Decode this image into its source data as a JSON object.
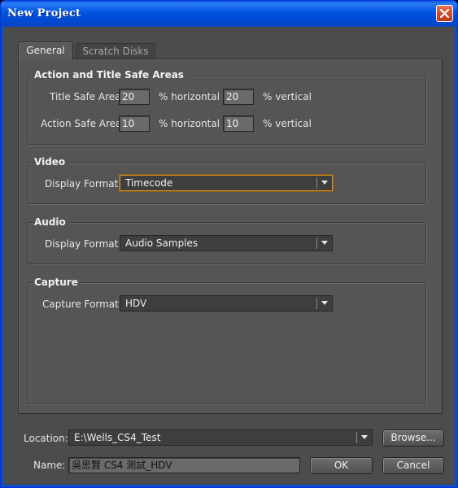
{
  "window": {
    "title": "New Project"
  },
  "tabs": [
    {
      "label": "General",
      "active": true
    },
    {
      "label": "Scratch Disks",
      "active": false
    }
  ],
  "safe_areas": {
    "title": "Action and Title Safe Areas",
    "title_safe_label": "Title Safe Area",
    "title_safe_h": "20",
    "title_safe_v": "20",
    "action_safe_label": "Action Safe Area",
    "action_safe_h": "10",
    "action_safe_v": "10",
    "unit_h": "% horizontal",
    "unit_v": "% vertical"
  },
  "video": {
    "title": "Video",
    "display_format_label": "Display Format:",
    "display_format": "Timecode"
  },
  "audio": {
    "title": "Audio",
    "display_format_label": "Display Format:",
    "display_format": "Audio Samples"
  },
  "capture": {
    "title": "Capture",
    "capture_format_label": "Capture Format:",
    "capture_format": "HDV"
  },
  "location": {
    "label": "Location:",
    "value": "E:\\Wells_CS4_Test",
    "browse_label": "Browse..."
  },
  "name": {
    "label": "Name:",
    "value": "吳思賢 CS4 測試_HDV"
  },
  "buttons": {
    "ok": "OK",
    "cancel": "Cancel"
  },
  "icons": {
    "close": "close-icon",
    "dropdown": "chevron-down-icon"
  },
  "colors": {
    "titlebar": "#0054e3",
    "dialog_bg": "#4c4c4c",
    "focus_ring": "#d9962a"
  }
}
